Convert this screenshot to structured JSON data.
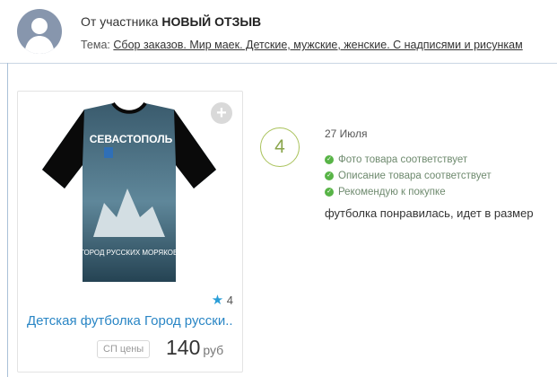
{
  "header": {
    "prefix": "От участника",
    "bold": "НОВЫЙ ОТЗЫВ",
    "topic_label": "Тема:",
    "topic_link": "Сбор заказов. Мир маек. Детские, мужские, женские. С надписями и рисункам"
  },
  "product": {
    "shirt_caption_top": "СЕВАСТОПОЛЬ",
    "shirt_caption_bottom": "ГОРОД РУССКИХ МОРЯКОВ",
    "rating": "4",
    "title": "Детская футболка Город русски...",
    "sp_badge": "СП цены",
    "price": "140",
    "currency": "руб"
  },
  "review": {
    "score": "4",
    "date": "27 Июля",
    "checks": [
      "Фото товара соответствует",
      "Описание товара соответствует",
      "Рекомендую к покупке"
    ],
    "text": "футболка понравилась, идет в размер"
  }
}
